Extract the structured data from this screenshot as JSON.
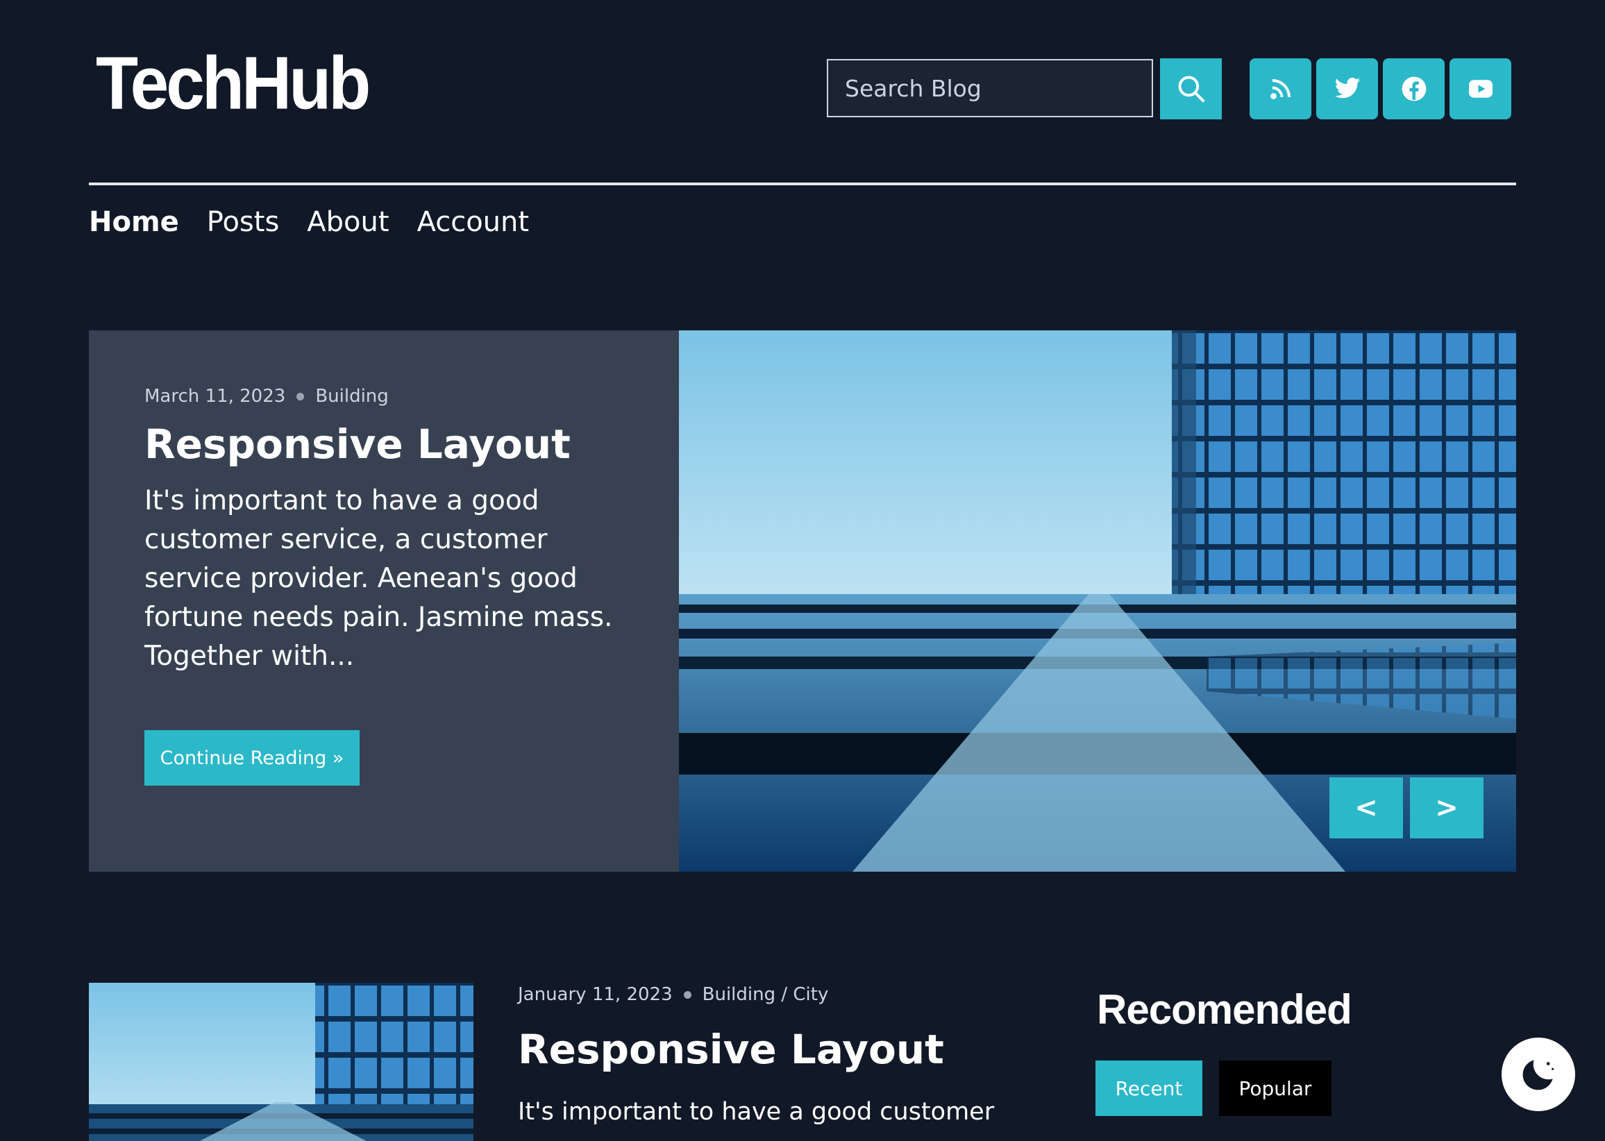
{
  "site": {
    "logo": "TechHub"
  },
  "search": {
    "placeholder": "Search Blog"
  },
  "social": [
    {
      "icon": "rss-icon"
    },
    {
      "icon": "twitter-icon"
    },
    {
      "icon": "facebook-icon"
    },
    {
      "icon": "youtube-icon"
    }
  ],
  "nav": {
    "items": [
      {
        "label": "Home",
        "active": true
      },
      {
        "label": "Posts"
      },
      {
        "label": "About"
      },
      {
        "label": "Account"
      }
    ]
  },
  "hero": {
    "date": "March 11, 2023",
    "category": "Building",
    "title": "Responsive Layout",
    "excerpt": "It's important to have a good customer service, a customer service provider. Aenean's good fortune needs pain. Jasmine mass. Together with...",
    "cta": "Continue Reading »",
    "prev": "<",
    "next": ">"
  },
  "post": {
    "date": "January 11, 2023",
    "category": "Building / City",
    "title": "Responsive Layout",
    "excerpt": "It's important to have a good customer"
  },
  "sidebar": {
    "title": "Recomended",
    "tabs": {
      "recent": "Recent",
      "popular": "Popular"
    }
  },
  "colors": {
    "accent": "#2bb8c9",
    "background": "#111827",
    "card": "#374151"
  }
}
